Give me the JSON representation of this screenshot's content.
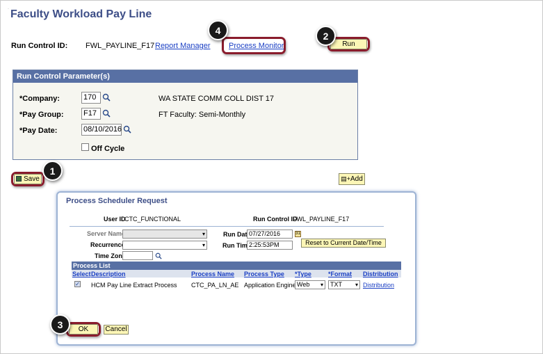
{
  "page": {
    "title": "Faculty Workload Pay Line",
    "run_control_label": "Run Control ID:",
    "run_control_value": "FWL_PAYLINE_F17",
    "report_manager": "Report Manager",
    "process_monitor": "Process Monitor",
    "run_button": "Run",
    "save_button": "Save",
    "add_button": "Add"
  },
  "params": {
    "heading": "Run Control Parameter(s)",
    "company_label": "*Company:",
    "company_value": "170",
    "company_desc": "WA STATE COMM COLL DIST 17",
    "paygroup_label": "*Pay Group:",
    "paygroup_value": "F17",
    "paygroup_desc": "FT Faculty: Semi-Monthly",
    "paydate_label": "*Pay Date:",
    "paydate_value": "08/10/2016",
    "offcycle_label": "Off Cycle"
  },
  "badges": {
    "b1": "1",
    "b2": "2",
    "b3": "3",
    "b4": "4"
  },
  "dialog": {
    "title": "Process Scheduler Request",
    "userid_label": "User ID",
    "userid_value": "CTC_FUNCTIONAL",
    "runctl_label": "Run Control ID",
    "runctl_value": "FWL_PAYLINE_F17",
    "server_label": "Server Name",
    "rundate_label": "Run Date",
    "rundate_value": "07/27/2016",
    "recurrence_label": "Recurrence",
    "runtime_label": "Run Time",
    "runtime_value": "2:25:53PM",
    "reset_button": "Reset to Current Date/Time",
    "timezone_label": "Time Zone",
    "process_list_heading": "Process List",
    "columns": [
      "Select",
      "Description",
      "Process Name",
      "Process Type",
      "*Type",
      "*Format",
      "Distribution"
    ],
    "row": {
      "description": "HCM Pay Line Extract Process",
      "process_name": "CTC_PA_LN_AE",
      "process_type": "Application Engine",
      "type": "Web",
      "format": "TXT",
      "distribution": "Distribution"
    },
    "ok_button": "OK",
    "cancel_button": "Cancel"
  },
  "colors": {
    "accent": "#3d4e87",
    "header": "#5870a4",
    "highlight": "#8a1c2c",
    "button": "#fcf6b6"
  }
}
